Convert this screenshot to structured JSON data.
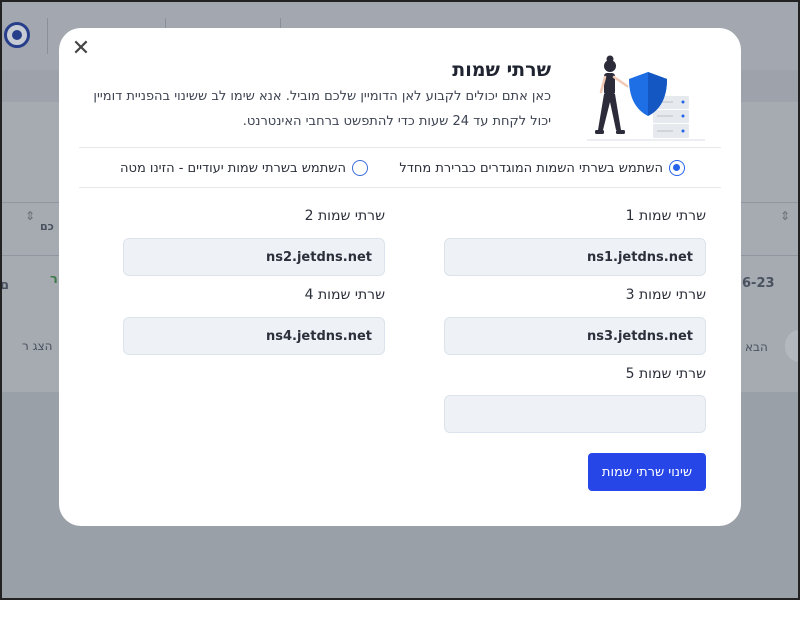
{
  "background": {
    "row_date": "6-23",
    "row_status": "ר",
    "row_left": "ם",
    "col_header": "כם",
    "next_label": "הבא",
    "prev_label": "הצג ר"
  },
  "modal": {
    "title": "שרתי שמות",
    "description": "כאן אתם יכולים לקבוע לאן הדומיין שלכם מוביל. אנא שימו לב ששינוי בהפניית דומיין יכול לקחת עד 24 שעות כדי להתפשט ברחבי האינטרנט.",
    "radio_default": "השתמש בשרתי השמות המוגדרים כברירת מחדל",
    "radio_custom": "השתמש בשרתי שמות יעודיים - הזינו מטה",
    "selected": "default",
    "fields": [
      {
        "label": "שרתי שמות 1",
        "value": "ns1.jetdns.net"
      },
      {
        "label": "שרתי שמות 2",
        "value": "ns2.jetdns.net"
      },
      {
        "label": "שרתי שמות 3",
        "value": "ns3.jetdns.net"
      },
      {
        "label": "שרתי שמות 4",
        "value": "ns4.jetdns.net"
      },
      {
        "label": "שרתי שמות 5",
        "value": ""
      }
    ],
    "submit_label": "שינוי שרתי שמות",
    "close_icon": "close-icon",
    "illustration_icon": "security-shield-server-icon"
  },
  "colors": {
    "accent": "#2563eb",
    "button": "#2746e8",
    "shield": "#1e6fe6",
    "field_bg": "#eef2f7"
  }
}
